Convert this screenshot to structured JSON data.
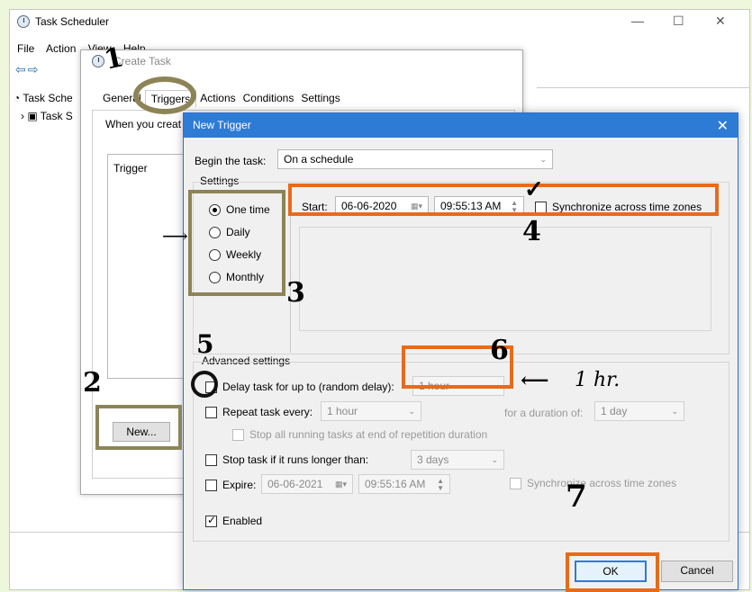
{
  "main_window": {
    "title": "Task Scheduler",
    "minimize": "—",
    "maximize": "☐",
    "close": "✕",
    "menu": [
      "File",
      "Action",
      "View",
      "Help"
    ],
    "tree": [
      "Task Sche",
      "Task S"
    ]
  },
  "create_task": {
    "title": "Create Task",
    "tabs": [
      "General",
      "Triggers",
      "Actions",
      "Conditions",
      "Settings"
    ],
    "description": "When you creat",
    "list_header": "Trigger",
    "new_button": "New..."
  },
  "new_trigger": {
    "title": "New Trigger",
    "begin_label": "Begin the task:",
    "begin_value": "On a schedule",
    "settings_label": "Settings",
    "radios": [
      "One time",
      "Daily",
      "Weekly",
      "Monthly"
    ],
    "start_label": "Start:",
    "start_date": "06-06-2020",
    "start_time": "09:55:13 AM",
    "sync_label": "Synchronize across time zones",
    "advanced_label": "Advanced settings",
    "delay_label": "Delay task for up to (random delay):",
    "delay_value": "1 hour",
    "repeat_label": "Repeat task every:",
    "repeat_value": "1 hour",
    "duration_label": "for a duration of:",
    "duration_value": "1 day",
    "stop_all_label": "Stop all running tasks at end of repetition duration",
    "stop_longer_label": "Stop task if it runs longer than:",
    "stop_longer_value": "3 days",
    "expire_label": "Expire:",
    "expire_date": "06-06-2021",
    "expire_time": "09:55:16 AM",
    "expire_sync_label": "Synchronize across time zones",
    "enabled_label": "Enabled",
    "ok": "OK",
    "cancel": "Cancel"
  },
  "annotations": {
    "n1": "1",
    "n2": "2",
    "n3": "3",
    "n4": "4",
    "n5": "5",
    "n6": "6",
    "n7": "7",
    "note": "1 hr."
  }
}
